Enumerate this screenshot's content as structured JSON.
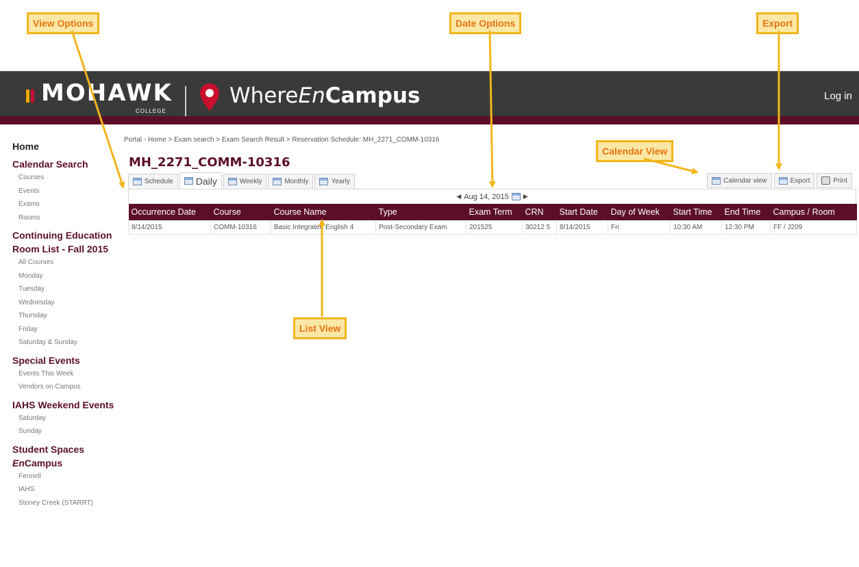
{
  "callouts": {
    "view_options": "View Options",
    "date_options": "Date Options",
    "export": "Export",
    "calendar_view": "Calendar View",
    "list_view": "List View"
  },
  "header": {
    "logo_text": "MOHAWK",
    "logo_sub": "COLLEGE",
    "brand_pre": "Where",
    "brand_en": "En",
    "brand_post": "Campus",
    "login": "Log in"
  },
  "sidebar": {
    "home": "Home",
    "sections": [
      {
        "title": "Calendar Search",
        "items": [
          "Courses",
          "Events",
          "Exams",
          "Rooms"
        ]
      },
      {
        "title": "Continuing Education Room List - Fall 2015",
        "items": [
          "All Courses",
          "Monday",
          "Tuesday",
          "Wednesday",
          "Thursday",
          "Friday",
          "Saturday & Sunday"
        ]
      },
      {
        "title": "Special Events",
        "items": [
          "Events This Week",
          "Vendors on Campus"
        ]
      },
      {
        "title": "IAHS Weekend Events",
        "items": [
          "Saturday",
          "Sunday"
        ]
      },
      {
        "title_em": "En",
        "title_rest": "Campus",
        "title": "Student Spaces",
        "items": [
          "Fennell",
          "IAHS",
          "Stoney Creek (STARRT)"
        ]
      }
    ]
  },
  "breadcrumb": "Portal - Home > Exam search > Exam Search Result > Reservation Schedule: MH_2271_COMM-10316",
  "page_title": "MH_2271_COMM-10316",
  "tabs": {
    "schedule": "Schedule",
    "daily": "Daily",
    "weekly": "Weekly",
    "monthly": "Monthly",
    "yearly": "Yearly"
  },
  "actions": {
    "calendar_view": "Calendar view",
    "export": "Export",
    "print": "Print"
  },
  "date_display": "Aug 14, 2015",
  "table": {
    "headers": [
      "Occurrence Date",
      "Course",
      "Course Name",
      "Type",
      "Exam Term",
      "CRN",
      "Start Date",
      "Day of Week",
      "Start Time",
      "End Time",
      "Campus / Room"
    ],
    "rows": [
      [
        "8/14/2015",
        "COMM-10316",
        "Basic Integrated English 4",
        "Post-Secondary Exam",
        "201525",
        "30212 5",
        "8/14/2015",
        "Fri",
        "10:30 AM",
        "12:30 PM",
        "FF / J209"
      ]
    ]
  },
  "colors": {
    "header_bg": "#3a3a3a",
    "accent_maroon": "#5b0f26",
    "callout_border": "#f3b51b",
    "callout_text": "#e8740f"
  }
}
